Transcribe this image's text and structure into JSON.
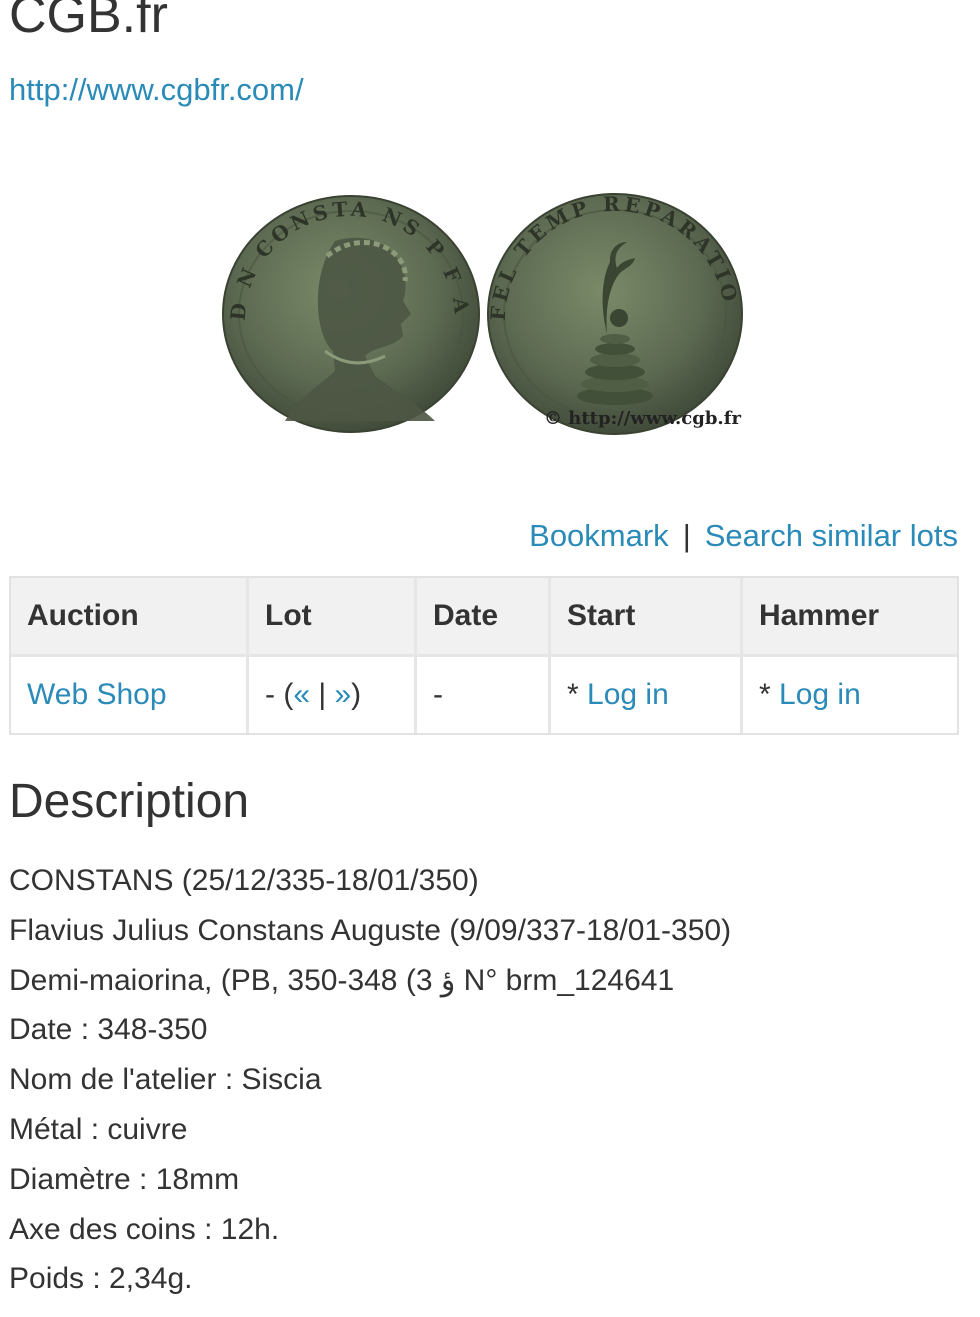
{
  "site": {
    "title": "CGB.fr",
    "url": "http://www.cgbfr.com/"
  },
  "image": {
    "copyright": "© http://www.cgb.fr",
    "obverse_legend": "D N CONSTA NS P F AVG",
    "reverse_legend": "FEL TEMP REPARATIO"
  },
  "actions": {
    "bookmark": "Bookmark",
    "separator": "|",
    "search_similar": "Search similar lots"
  },
  "table": {
    "headers": [
      "Auction",
      "Lot",
      "Date",
      "Start",
      "Hammer"
    ],
    "row": {
      "auction": "Web Shop",
      "lot_prefix": "- (",
      "lot_prev": "«",
      "lot_sep": " | ",
      "lot_next": "»",
      "lot_suffix": ")",
      "date": "-",
      "start_prefix": "* ",
      "start_link": "Log in",
      "hammer_prefix": "* ",
      "hammer_link": "Log in"
    }
  },
  "description": {
    "title": "Description",
    "lines": [
      "CONSTANS (25/12/335-18/01/350)",
      "Flavius Julius Constans Auguste (9/09/337-18/01-350)",
      "Demi-maiorina, (PB, 350-348 (3 ؤ N° brm_124641",
      "Date : 348-350",
      "Nom de l'atelier : Siscia",
      "Métal : cuivre",
      "Diamètre : 18mm",
      "Axe des coins : 12h.",
      "Poids : 2,34g."
    ]
  },
  "colors": {
    "link": "#2a8ab8",
    "text": "#333333",
    "table_header_bg": "#f1f1f1",
    "coin_bronze": "#5d6a52"
  }
}
